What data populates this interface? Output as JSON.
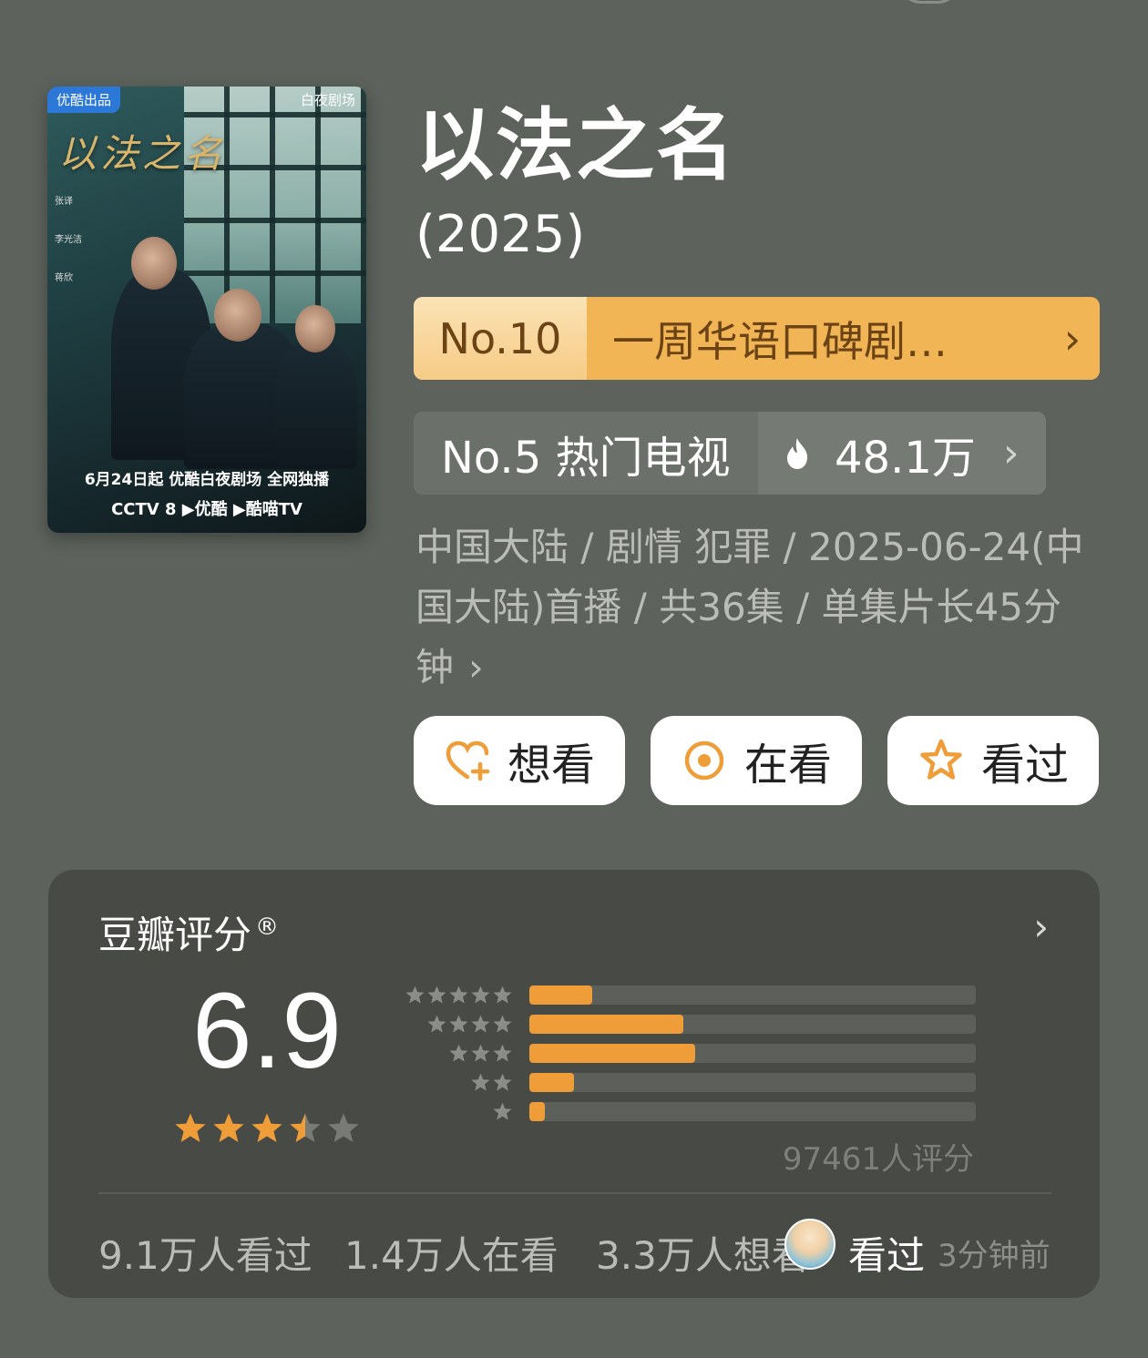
{
  "poster": {
    "badge": "优酷出品",
    "studio": "白夜剧场",
    "title": "以法之名",
    "cast": [
      "张译",
      "李光洁",
      "蒋欣"
    ],
    "release_line": "6月24日起 优酷白夜剧场 全网独播",
    "platforms": "CCTV 8  ▶优酷  ▶酷喵TV"
  },
  "show": {
    "title": "以法之名",
    "year": "(2025)"
  },
  "ranking_primary": {
    "rank": "No.10",
    "label": "一周华语口碑剧…",
    "arrow": "›"
  },
  "ranking_secondary": {
    "label": "No.5 热门电视",
    "heat": "48.1万",
    "arrow": "›"
  },
  "meta": {
    "text": "中国大陆 / 剧情 犯罪 / 2025-06-24(中国大陆)首播 / 共36集 / 单集片长45分钟",
    "arrow": "›"
  },
  "actions": [
    {
      "label": "想看",
      "icon": "heart-plus-icon"
    },
    {
      "label": "在看",
      "icon": "target-icon"
    },
    {
      "label": "看过",
      "icon": "star-outline-icon"
    }
  ],
  "rating": {
    "title": "豆瓣评分",
    "mark": "®",
    "score": "6.9",
    "stars_value": 3.5,
    "count_text": "97461人评分",
    "distribution": [
      {
        "stars": 5,
        "fraction": 0.14
      },
      {
        "stars": 4,
        "fraction": 0.345
      },
      {
        "stars": 3,
        "fraction": 0.372
      },
      {
        "stars": 2,
        "fraction": 0.1
      },
      {
        "stars": 1,
        "fraction": 0.034
      }
    ],
    "stats": [
      "9.1万人看过",
      "1.4万人在看",
      "3.3万人想看"
    ],
    "recent": {
      "label": "看过",
      "time": "3分钟前"
    }
  },
  "colors": {
    "accent": "#ee9d39",
    "background": "#5d625c",
    "card": "#474a45"
  }
}
